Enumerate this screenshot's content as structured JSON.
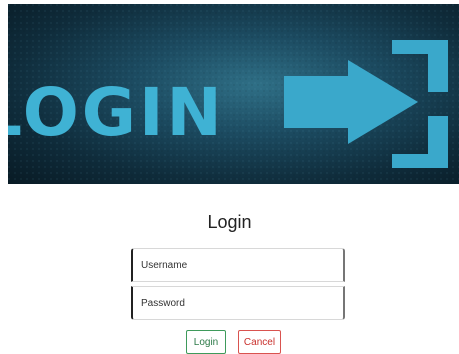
{
  "banner": {
    "text": "LOGIN",
    "text_color": "#3fb2d4",
    "icon": "login-arrow-icon"
  },
  "form": {
    "title": "Login",
    "username_placeholder": "Username",
    "password_placeholder": "Password",
    "login_label": "Login",
    "cancel_label": "Cancel"
  },
  "colors": {
    "login_button": "#3e9a5b",
    "cancel_button": "#d9534f"
  }
}
